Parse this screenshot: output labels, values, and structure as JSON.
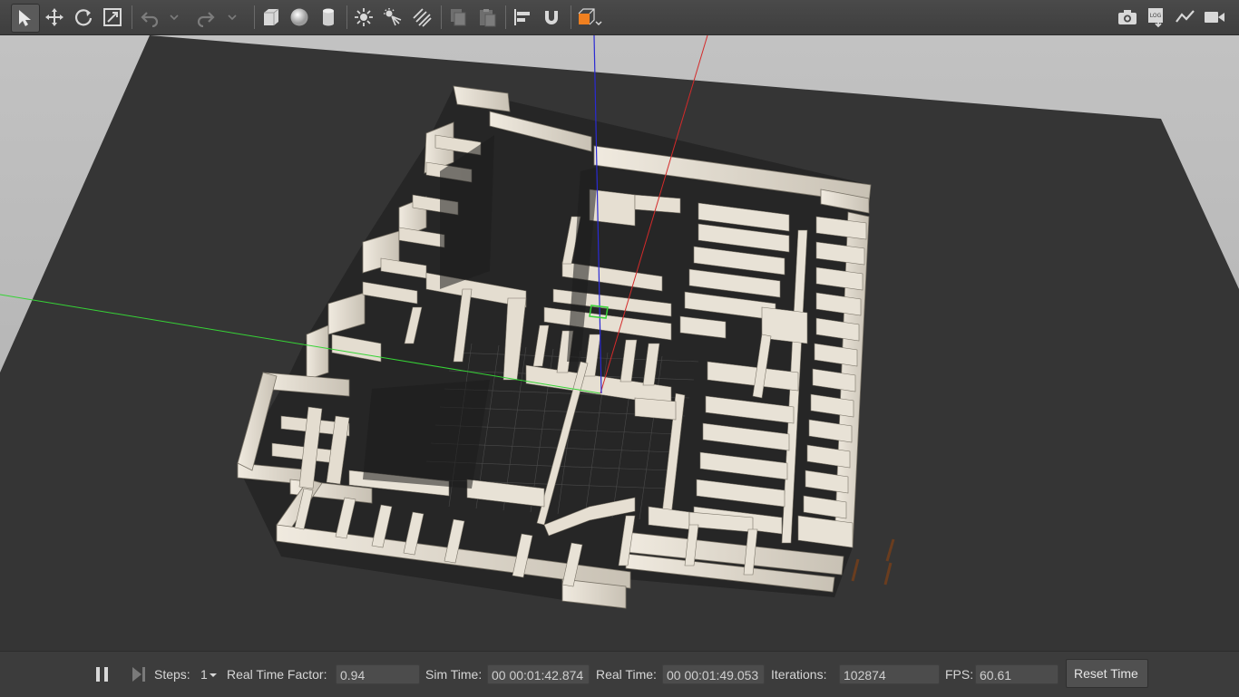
{
  "toolbar": {
    "left_tools": [
      "select-mode-icon",
      "translate-mode-icon",
      "rotate-mode-icon",
      "scale-mode-icon",
      "undo-icon",
      "redo-icon",
      "box-shape-icon",
      "sphere-shape-icon",
      "cylinder-shape-icon",
      "point-light-icon",
      "spot-light-icon",
      "directional-light-icon",
      "copy-icon",
      "paste-icon",
      "align-icon",
      "snap-icon",
      "view-angle-icon"
    ],
    "right_tools": [
      "screenshot-icon",
      "log-icon",
      "plot-icon",
      "video-record-icon"
    ],
    "log_badge": "LOG"
  },
  "colors": {
    "ground": "#353535",
    "sky": "#b8b8b8",
    "wall": "#e8e2d6",
    "wall_shade": "#8f8a80",
    "x_axis": "#d42a2a",
    "y_axis": "#36d436",
    "z_axis": "#2a2ad4",
    "accent": "#f08020"
  },
  "status": {
    "steps_label": "Steps:",
    "steps_value": "1",
    "rtf_label": "Real Time Factor:",
    "rtf_value": "0.94",
    "sim_label": "Sim Time:",
    "sim_value": "00 00:01:42.874",
    "real_label": "Real Time:",
    "real_value": "00 00:01:49.053",
    "iter_label": "Iterations:",
    "iter_value": "102874",
    "fps_label": "FPS:",
    "fps_value": "60.61",
    "reset_label": "Reset Time"
  }
}
